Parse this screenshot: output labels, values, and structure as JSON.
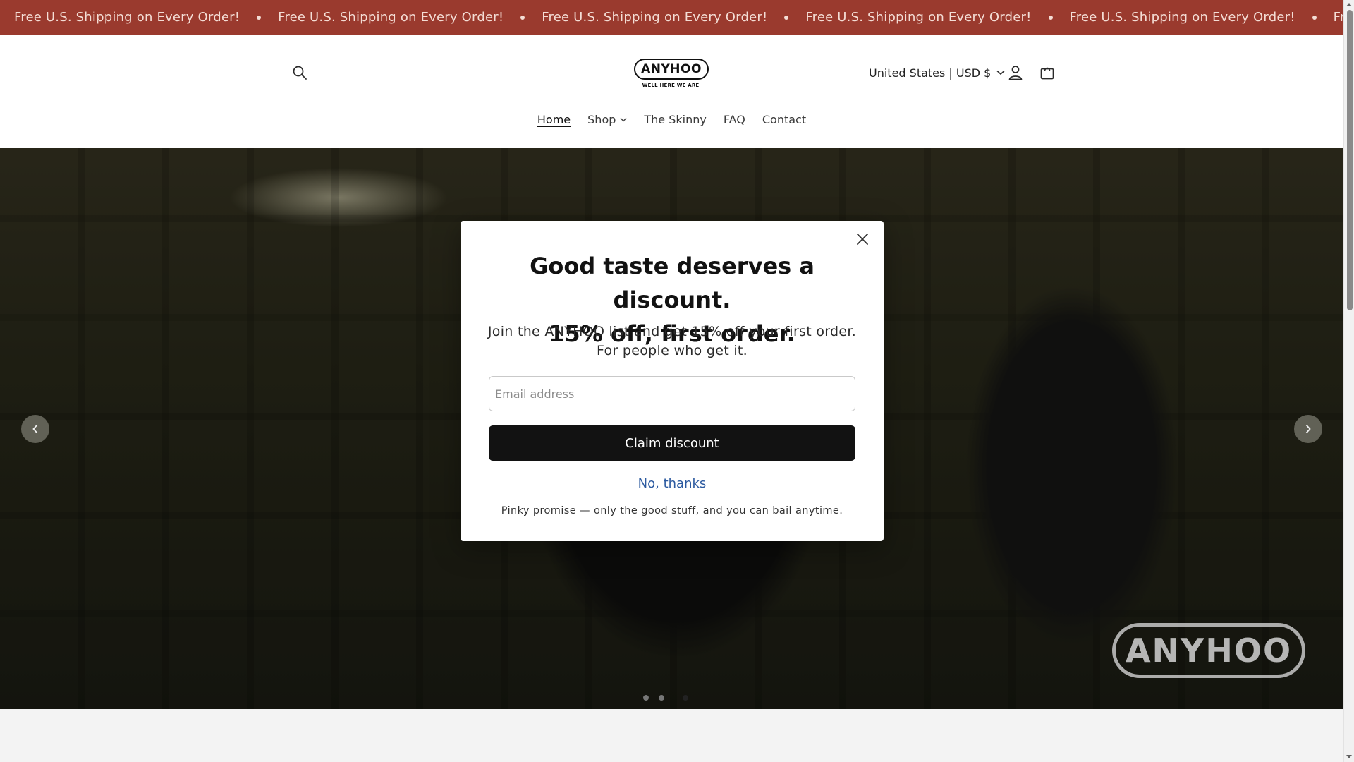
{
  "announcement": {
    "items": [
      "Free U.S. Shipping on Every Order!",
      "Free U.S. Shipping on Every Order!",
      "Free U.S. Shipping on Every Order!",
      "Free U.S. Shipping on Every Order!",
      "Free U.S. Shipping on Every Order!",
      "Free U.S. Shipping on Every"
    ],
    "background": "#9a3a2e"
  },
  "header": {
    "logo_text": "ANYHOO",
    "logo_tagline": "WELL HERE WE ARE",
    "country_selector": "United States | USD $",
    "icons": [
      "search-icon",
      "account-icon",
      "cart-icon",
      "chevron-down-icon"
    ]
  },
  "nav": {
    "items": [
      {
        "label": "Home",
        "active": true
      },
      {
        "label": "Shop",
        "active": false,
        "has_dropdown": true
      },
      {
        "label": "The Skinny",
        "active": false
      },
      {
        "label": "FAQ",
        "active": false
      },
      {
        "label": "Contact",
        "active": false
      }
    ]
  },
  "hero": {
    "watermark": "ANYHOO",
    "slides_count": 3,
    "active_slide": 3
  },
  "modal": {
    "title_line1": "Good taste deserves a discount.",
    "title_line2": "15% off, first order.",
    "subtitle": "Join the ANYHOO list and get 15% off your first order. For people who get it.",
    "email_placeholder": "Email address",
    "email_value": "",
    "claim_label": "Claim discount",
    "decline_label": "No, thanks",
    "footnote": "Pinky promise — only the good stuff, and you can bail anytime.",
    "accent_color": "#121212",
    "link_color": "#2c5aa0"
  }
}
